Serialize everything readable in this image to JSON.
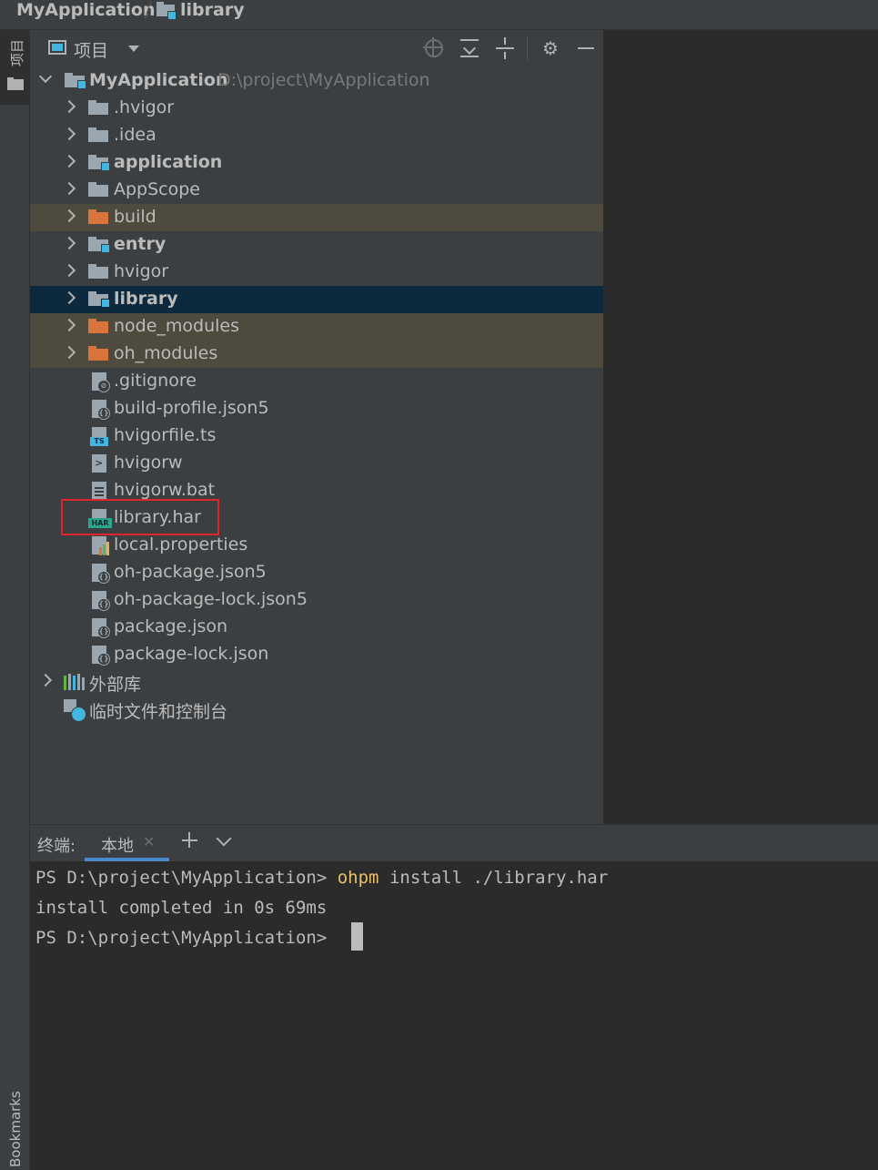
{
  "breadcrumb": {
    "project": "MyApplication",
    "module": "library"
  },
  "left_stripe": {
    "project_tab": "项目",
    "bookmarks_tab": "Bookmarks"
  },
  "project_panel": {
    "view_mode": "项目",
    "toolbar_icons": [
      "locate-icon",
      "expand-all-icon",
      "collapse-all-icon",
      "gear-icon",
      "minimize-icon"
    ],
    "root": {
      "name": "MyApplication",
      "path": "D:\\project\\MyApplication"
    },
    "items": [
      {
        "label": ".hvigor",
        "kind": "folder",
        "expandable": true
      },
      {
        "label": ".idea",
        "kind": "folder",
        "expandable": true
      },
      {
        "label": "application",
        "kind": "module-folder",
        "expandable": true,
        "bold": true
      },
      {
        "label": "AppScope",
        "kind": "folder",
        "expandable": true
      },
      {
        "label": "build",
        "kind": "excluded-folder",
        "expandable": true
      },
      {
        "label": "entry",
        "kind": "module-folder",
        "expandable": true,
        "bold": true
      },
      {
        "label": "hvigor",
        "kind": "folder",
        "expandable": true
      },
      {
        "label": "library",
        "kind": "module-folder",
        "expandable": true,
        "bold": true,
        "selected": true
      },
      {
        "label": "node_modules",
        "kind": "excluded-folder",
        "expandable": true
      },
      {
        "label": "oh_modules",
        "kind": "excluded-folder",
        "expandable": true
      },
      {
        "label": ".gitignore",
        "kind": "gitignore-file"
      },
      {
        "label": "build-profile.json5",
        "kind": "json-file"
      },
      {
        "label": "hvigorfile.ts",
        "kind": "ts-file"
      },
      {
        "label": "hvigorw",
        "kind": "shell-file"
      },
      {
        "label": "hvigorw.bat",
        "kind": "text-file"
      },
      {
        "label": "library.har",
        "kind": "har-file",
        "highlighted": true
      },
      {
        "label": "local.properties",
        "kind": "properties-file"
      },
      {
        "label": "oh-package.json5",
        "kind": "json-file"
      },
      {
        "label": "oh-package-lock.json5",
        "kind": "json-file"
      },
      {
        "label": "package.json",
        "kind": "json-file"
      },
      {
        "label": "package-lock.json",
        "kind": "json-file"
      }
    ],
    "external_libraries": "外部库",
    "scratches": "临时文件和控制台"
  },
  "terminal": {
    "title": "终端:",
    "tab_label": "本地",
    "add_icon": "plus-icon",
    "dropdown_icon": "chevron-down-icon",
    "lines": [
      {
        "prompt": "PS D:\\project\\MyApplication> ",
        "command": "ohpm",
        "args": " install ./library.har"
      },
      {
        "output": "install completed in 0s 69ms"
      },
      {
        "prompt": "PS D:\\project\\MyApplication> "
      }
    ],
    "command_color": "#e8bf6a"
  },
  "colors": {
    "selection": "#0d293e",
    "excluded": "#4e4a3d",
    "highlight_box": "#e0252b",
    "excluded_folder": "#d9753b",
    "module_badge": "#40b6e0"
  }
}
